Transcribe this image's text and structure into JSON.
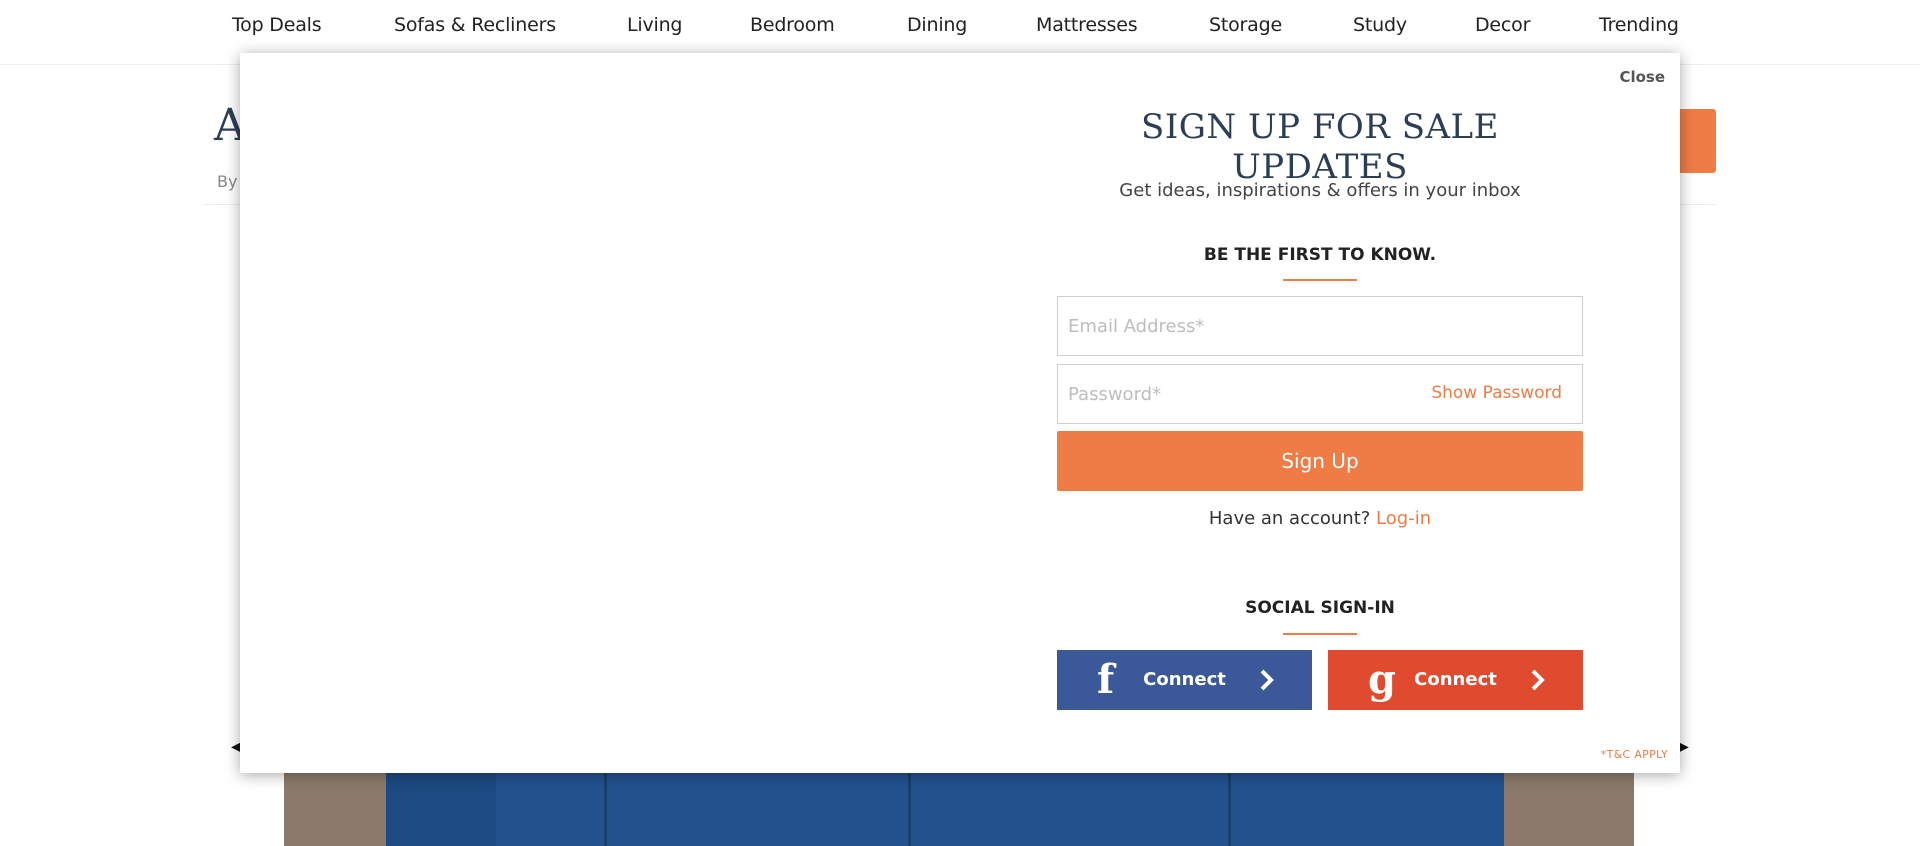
{
  "nav": {
    "items": [
      {
        "label": "Top Deals"
      },
      {
        "label": "Sofas & Recliners"
      },
      {
        "label": "Living"
      },
      {
        "label": "Bedroom"
      },
      {
        "label": "Dining"
      },
      {
        "label": "Mattresses"
      },
      {
        "label": "Storage"
      },
      {
        "label": "Study"
      },
      {
        "label": "Decor"
      },
      {
        "label": "Trending"
      }
    ]
  },
  "background_page": {
    "title_fragment": "A",
    "byline_fragment": "By"
  },
  "modal": {
    "close_label": "Close",
    "title": "SIGN UP FOR SALE UPDATES",
    "subtitle": "Get ideas, inspirations & offers in your inbox",
    "first_to_know": "BE THE FIRST TO KNOW.",
    "email_placeholder": "Email Address*",
    "email_value": "",
    "password_placeholder": "Password*",
    "password_value": "",
    "show_password_label": "Show Password",
    "signup_label": "Sign Up",
    "have_account_text": "Have an account?",
    "login_label": "Log-in",
    "social_title": "SOCIAL SIGN-IN",
    "facebook": {
      "icon": "f",
      "label": "Connect",
      "color": "#3b5998"
    },
    "google": {
      "icon": "g",
      "label": "Connect",
      "color": "#e04a2f"
    },
    "tnc": "*T&C APPLY"
  },
  "colors": {
    "accent": "#ef7b45",
    "heading": "#2c3e55"
  }
}
